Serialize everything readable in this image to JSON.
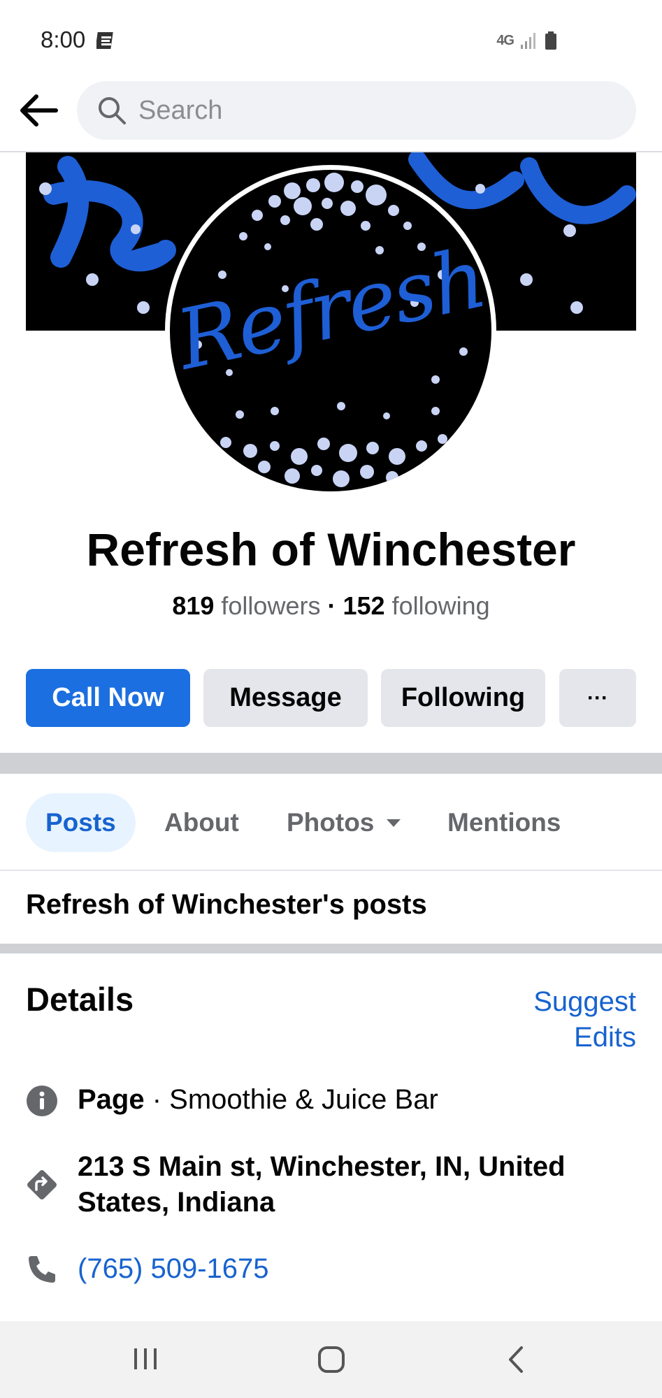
{
  "status_bar": {
    "time": "8:00",
    "network": "4G"
  },
  "search": {
    "placeholder": "Search"
  },
  "page": {
    "name": "Refresh of Winchester",
    "followers_count": "819",
    "followers_label": "followers",
    "separator": "·",
    "following_count": "152",
    "following_label": "following",
    "logo_text": "Refresh"
  },
  "actions": {
    "call_now": "Call Now",
    "message": "Message",
    "following": "Following",
    "more": "···"
  },
  "tabs": [
    {
      "label": "Posts",
      "active": true
    },
    {
      "label": "About",
      "active": false
    },
    {
      "label": "Photos",
      "active": false
    },
    {
      "label": "Mentions",
      "active": false
    }
  ],
  "posts_heading": "Refresh of Winchester's posts",
  "details": {
    "heading": "Details",
    "suggest_edits": "Suggest Edits",
    "category_label": "Page",
    "category_sep": " · ",
    "category_value": "Smoothie & Juice Bar",
    "address": "213 S Main st, Winchester, IN, United States, Indiana",
    "phone": "(765) 509-1675"
  },
  "colors": {
    "accent": "#1b6fe0",
    "link": "#1763cf",
    "button_gray": "#e4e6eb",
    "logo_blue": "#1e5fd6",
    "dot": "#c9d4f5"
  }
}
